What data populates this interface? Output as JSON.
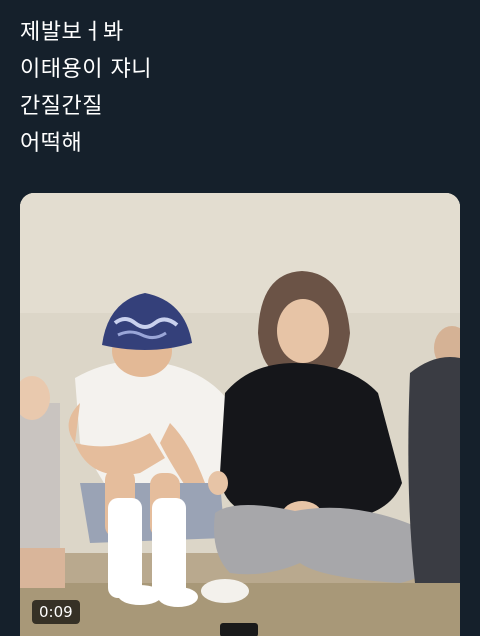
{
  "tweet": {
    "lines": [
      "제발보ㅓ봐",
      "이태용이 쟈니",
      "간질간질",
      "어떡해"
    ]
  },
  "video": {
    "duration": "0:09"
  }
}
